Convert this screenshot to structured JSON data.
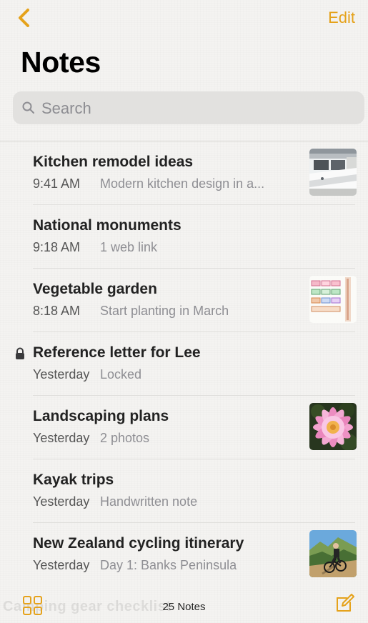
{
  "nav": {
    "edit_label": "Edit"
  },
  "header": {
    "title": "Notes"
  },
  "search": {
    "placeholder": "Search"
  },
  "notes": [
    {
      "title": "Kitchen remodel ideas",
      "time": "9:41 AM",
      "preview": "Modern kitchen design in a...",
      "thumbnail": "kitchen-photo",
      "locked": false
    },
    {
      "title": "National monuments",
      "time": "9:18 AM",
      "preview": "1 web link",
      "locked": false
    },
    {
      "title": "Vegetable garden",
      "time": "8:18 AM",
      "preview": "Start planting in March",
      "thumbnail": "garden-grid-sketch",
      "locked": false
    },
    {
      "title": "Reference letter for Lee",
      "time": "Yesterday",
      "preview": "Locked",
      "locked": true
    },
    {
      "title": "Landscaping plans",
      "time": "Yesterday",
      "preview": "2 photos",
      "thumbnail": "pink-flower-photo",
      "locked": false
    },
    {
      "title": "Kayak trips",
      "time": "Yesterday",
      "preview": "Handwritten note",
      "locked": false
    },
    {
      "title": "New Zealand cycling itinerary",
      "time": "Yesterday",
      "preview": "Day 1: Banks Peninsula",
      "thumbnail": "cycling-photo",
      "locked": false
    }
  ],
  "footer": {
    "notes_count": "25 Notes",
    "partial_next_note": "Camping gear checklist"
  },
  "theme": {
    "accent": "#E5A21B",
    "background": "#F4F3F1"
  }
}
